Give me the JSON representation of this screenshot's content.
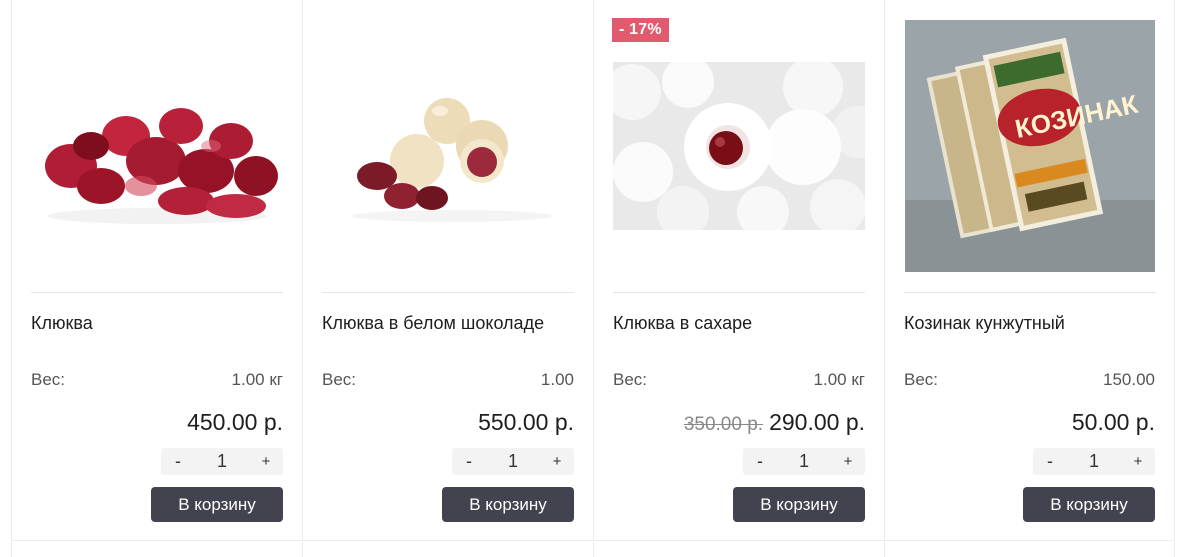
{
  "products": [
    {
      "title": "Клюква",
      "weight_label": "Вес:",
      "weight_value": "1.00 кг",
      "old_price": "",
      "price": "450.00 р.",
      "quantity": "1",
      "qty_minus": "-",
      "qty_plus": "+",
      "cart_label": "В корзину",
      "image": "dried-cranberries-image"
    },
    {
      "title": "Клюква в белом шоколаде",
      "weight_label": "Вес:",
      "weight_value": "1.00",
      "old_price": "",
      "price": "550.00 р.",
      "quantity": "1",
      "qty_minus": "-",
      "qty_plus": "+",
      "cart_label": "В корзину",
      "image": "cranberries-in-white-chocolate-image"
    },
    {
      "badge": "- 17%",
      "title": "Клюква в сахаре",
      "weight_label": "Вес:",
      "weight_value": "1.00 кг",
      "old_price": "350.00 р.",
      "price": "290.00 р.",
      "quantity": "1",
      "qty_minus": "-",
      "qty_plus": "+",
      "cart_label": "В корзину",
      "image": "sugared-cranberries-image"
    },
    {
      "title": "Козинак кунжутный",
      "weight_label": "Вес:",
      "weight_value": "150.00",
      "old_price": "",
      "price": "50.00 р.",
      "quantity": "1",
      "qty_minus": "-",
      "qty_plus": "+",
      "cart_label": "В корзину",
      "image": "sesame-kozinak-image",
      "package_text": "КОЗИНАК"
    }
  ],
  "colors": {
    "badge": "#e15a6d",
    "cart_button": "#434350",
    "border": "#ececec"
  }
}
